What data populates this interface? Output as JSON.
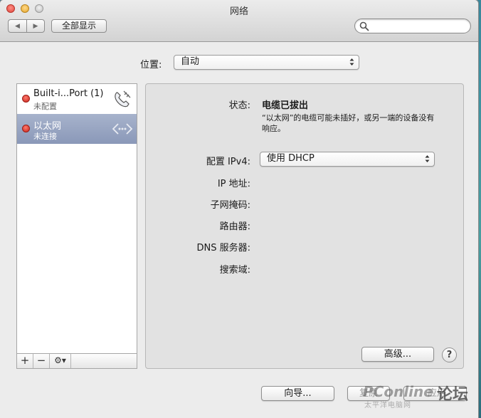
{
  "window": {
    "title": "网络"
  },
  "toolbar": {
    "back_icon": "chevron-left-icon",
    "forward_icon": "chevron-right-icon",
    "show_all_label": "全部显示",
    "search_placeholder": ""
  },
  "location": {
    "label": "位置:",
    "value": "自动"
  },
  "services": [
    {
      "name": "Built-i...Port (1)",
      "status": "未配置",
      "icon": "phone-modem-icon",
      "status_color": "#d9291f"
    },
    {
      "name": "以太网",
      "status": "未连接",
      "icon": "ethernet-arrows-icon",
      "status_color": "#d9291f"
    }
  ],
  "sidebar_toolbar": {
    "add": "+",
    "remove": "−",
    "gear_icon": "gear-icon"
  },
  "detail": {
    "status_label": "状态:",
    "status_value": "电缆已拔出",
    "status_description": "“以太网”的电缆可能未插好，或另一端的设备没有响应。",
    "ipv4_label": "配置 IPv4:",
    "ipv4_value": "使用 DHCP",
    "ip_label": "IP 地址:",
    "subnet_label": "子网掩码:",
    "router_label": "路由器:",
    "dns_label": "DNS 服务器:",
    "search_domain_label": "搜索域:",
    "advanced_button": "高级...",
    "help_button": "?"
  },
  "footer": {
    "assist_button": "向导...",
    "revert_button": "复原",
    "apply_button": "应用"
  },
  "watermark": {
    "brand": "PConline",
    "forum": "论坛",
    "sub": "太平洋电脑网"
  },
  "colors": {
    "selected_row": "#94a1bf",
    "status_red": "#d9291f",
    "panel_bg": "#e2e2e2"
  }
}
